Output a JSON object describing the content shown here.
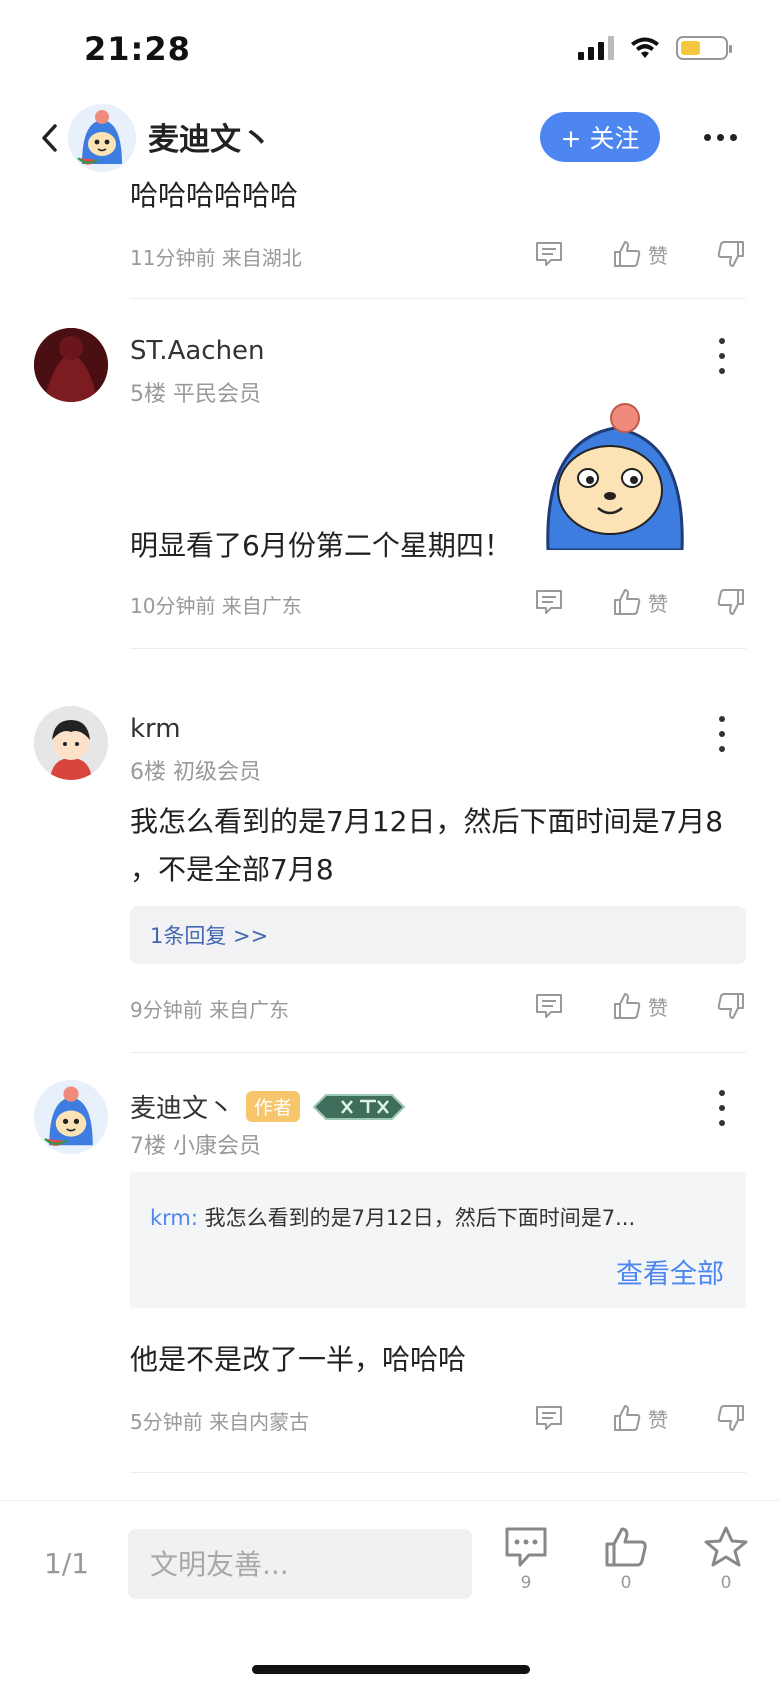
{
  "status_bar": {
    "time": "21:28"
  },
  "header": {
    "name": "麦迪文丶",
    "follow_label": "+ 关注"
  },
  "comments": [
    {
      "text": "哈哈哈哈哈哈",
      "meta": "11分钟前 来自湖北",
      "like_label": "赞"
    },
    {
      "username": "ST.Aachen",
      "floor": "5楼 平民会员",
      "text": "明显看了6月份第二个星期四！",
      "meta": "10分钟前 来自广东",
      "like_label": "赞"
    },
    {
      "username": "krm",
      "floor": "6楼 初级会员",
      "text": "我怎么看到的是7月12日，然后下面时间是7月8 ，不是全部7月8",
      "reply_link": "1条回复 >>",
      "meta": "9分钟前 来自广东",
      "like_label": "赞"
    },
    {
      "username": "麦迪文丶",
      "author_badge": "作者",
      "floor": "7楼 小康会员",
      "quote_user": "krm:",
      "quote_text": "我怎么看到的是7月12日，然后下面时间是7...",
      "quote_more": "查看全部",
      "text": "他是不是改了一半，哈哈哈",
      "meta": "5分钟前 来自内蒙古",
      "like_label": "赞"
    }
  ],
  "bottom_bar": {
    "page": "1/1",
    "input_placeholder": "文明友善...",
    "comment_count": "9",
    "like_count": "0",
    "star_count": "0"
  },
  "colors": {
    "accent": "#4d86f0",
    "author_badge": "#f6c56c",
    "reply_link": "#4267b2"
  },
  "icons": [
    "chevron-left-icon",
    "more-horizontal-icon",
    "kebab-icon",
    "comment-icon",
    "thumbs-up-icon",
    "thumbs-down-icon",
    "star-icon"
  ]
}
